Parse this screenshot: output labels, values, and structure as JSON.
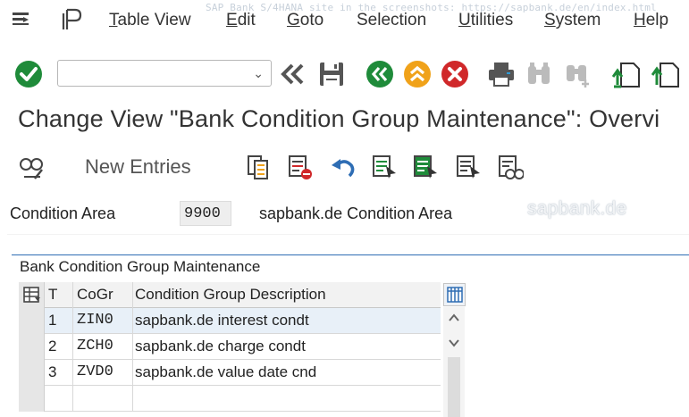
{
  "watermark_top": "SAP Bank S/4HANA site in the screenshots: https://sapbank.de/en/index.html",
  "menu": {
    "items": [
      {
        "label": "Table View",
        "mnemonic": "T",
        "rest": "able View"
      },
      {
        "label": "Edit",
        "mnemonic": "E",
        "rest": "dit"
      },
      {
        "label": "Goto",
        "mnemonic": "G",
        "rest": "oto"
      },
      {
        "label": "Selection",
        "mnemonic": "",
        "rest": "Selection"
      },
      {
        "label": "Utilities",
        "mnemonic": "U",
        "rest": "tilities"
      },
      {
        "label": "System",
        "mnemonic": "S",
        "rest": "ystem"
      },
      {
        "label": "Help",
        "mnemonic": "H",
        "rest": "elp"
      }
    ]
  },
  "toolbar": {
    "command_field_value": "",
    "icons": [
      "enter-check-icon",
      "command-field",
      "back-double-arrow-icon",
      "save-icon",
      "back-icon",
      "exit-icon",
      "cancel-icon",
      "print-icon",
      "find-icon",
      "find-next-icon",
      "first-page-icon",
      "previous-page-icon"
    ]
  },
  "title": "Change View \"Bank Condition Group Maintenance\": Overvi",
  "app_toolbar": {
    "new_entries": "New Entries"
  },
  "fields": {
    "condition_area_label": "Condition Area",
    "condition_area_value": "9900",
    "condition_area_desc": "sapbank.de Condition Area"
  },
  "watermark": "sapbank.de",
  "section": {
    "title": "Bank Condition Group Maintenance",
    "columns": [
      "T",
      "CoGr",
      "Condition Group Description"
    ],
    "rows": [
      {
        "t": "1",
        "cogr": "ZIN0",
        "desc": "sapbank.de interest condt"
      },
      {
        "t": "2",
        "cogr": "ZCH0",
        "desc": "sapbank.de charge condt"
      },
      {
        "t": "3",
        "cogr": "ZVD0",
        "desc": "sapbank.de value date cnd"
      }
    ]
  },
  "colors": {
    "accent_blue": "#2e6db4",
    "green": "#1f8b3a",
    "orange": "#f0a21a",
    "red": "#d0282a"
  }
}
